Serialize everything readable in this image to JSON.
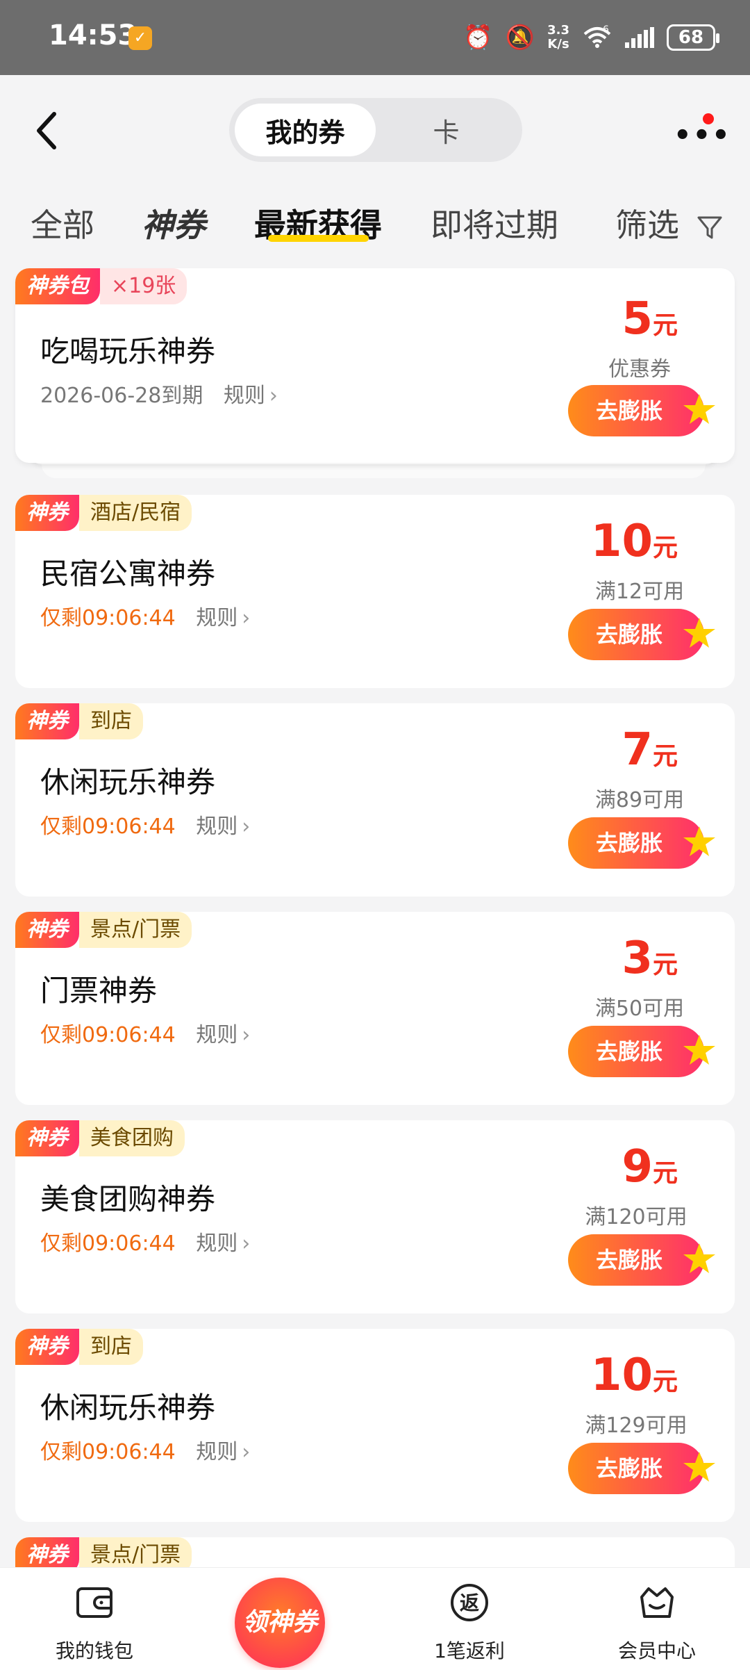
{
  "status_bar": {
    "time": "14:53",
    "net_speed_top": "3.3",
    "net_speed_bottom": "K/s",
    "network_type": "6",
    "battery": "68",
    "icons": [
      "alarm-icon",
      "mute-icon",
      "wifi-icon",
      "signal-icon",
      "battery-icon"
    ]
  },
  "header": {
    "segments": [
      "我的券",
      "卡"
    ],
    "active_segment": "我的券"
  },
  "tabs": {
    "all": "全部",
    "shen": "神券",
    "latest": "最新获得",
    "expiring": "即将过期",
    "filter": "筛选"
  },
  "cards": [
    {
      "tag": "神券包",
      "sub_tag": "×19张",
      "title": "吃喝玩乐神券",
      "meta_prefix": "2026-06-28到期",
      "rule": "规则",
      "amount": "5",
      "unit": "元",
      "condition": "优惠券",
      "button": "去膨胀"
    },
    {
      "tag": "神券",
      "sub_tag": "酒店/民宿",
      "title": "民宿公寓神券",
      "meta_prefix": "仅剩09:06:44",
      "rule": "规则",
      "amount": "10",
      "unit": "元",
      "condition": "满12可用",
      "button": "去膨胀"
    },
    {
      "tag": "神券",
      "sub_tag": "到店",
      "title": "休闲玩乐神券",
      "meta_prefix": "仅剩09:06:44",
      "rule": "规则",
      "amount": "7",
      "unit": "元",
      "condition": "满89可用",
      "button": "去膨胀"
    },
    {
      "tag": "神券",
      "sub_tag": "景点/门票",
      "title": "门票神券",
      "meta_prefix": "仅剩09:06:44",
      "rule": "规则",
      "amount": "3",
      "unit": "元",
      "condition": "满50可用",
      "button": "去膨胀"
    },
    {
      "tag": "神券",
      "sub_tag": "美食团购",
      "title": "美食团购神券",
      "meta_prefix": "仅剩09:06:44",
      "rule": "规则",
      "amount": "9",
      "unit": "元",
      "condition": "满120可用",
      "button": "去膨胀"
    },
    {
      "tag": "神券",
      "sub_tag": "到店",
      "title": "休闲玩乐神券",
      "meta_prefix": "仅剩09:06:44",
      "rule": "规则",
      "amount": "10",
      "unit": "元",
      "condition": "满129可用",
      "button": "去膨胀"
    },
    {
      "tag": "神券",
      "sub_tag": "景点/门票"
    }
  ],
  "bottom_nav": {
    "wallet": "我的钱包",
    "center": "领神券",
    "rebate": "1笔返利",
    "rebate_icon_char": "返",
    "member": "会员中心"
  },
  "colors": {
    "accent_orange": "#ff7a1f",
    "accent_pink": "#ff2e6a",
    "price_red": "#f0301e",
    "countdown_orange": "#f06a10",
    "tab_underline": "#ffd400"
  }
}
